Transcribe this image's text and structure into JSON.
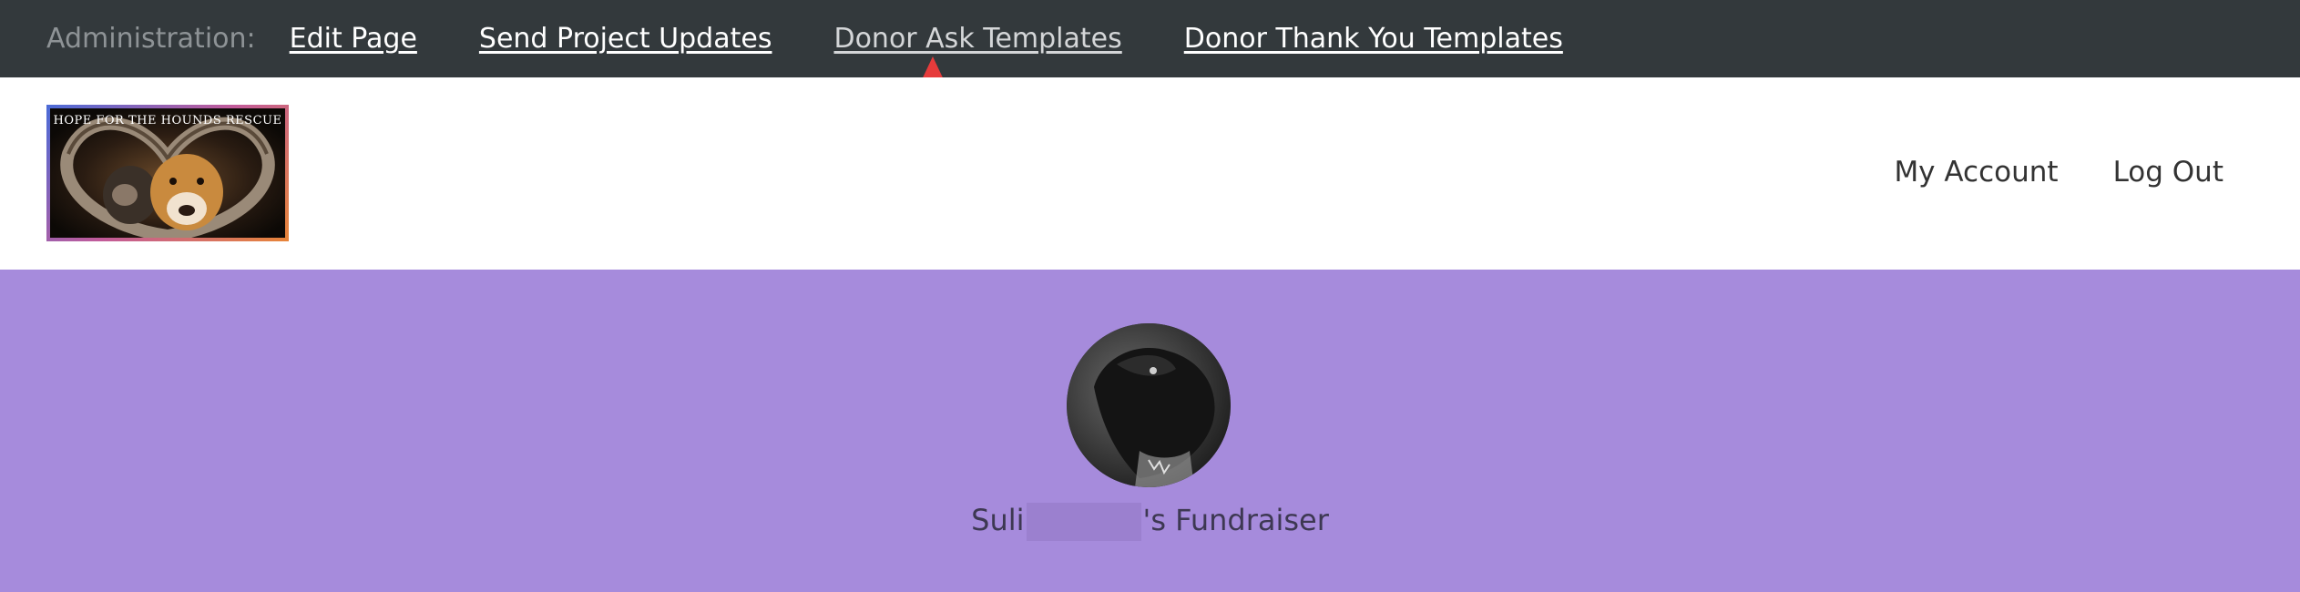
{
  "admin_bar": {
    "label": "Administration:",
    "links": [
      {
        "label": "Edit Page"
      },
      {
        "label": "Send Project Updates"
      },
      {
        "label": "Donor Ask Templates"
      },
      {
        "label": "Donor Thank You Templates"
      }
    ]
  },
  "header": {
    "logo_text": "HOPE FOR THE HOUNDS RESCUE",
    "nav": [
      {
        "label": "My Account"
      },
      {
        "label": "Log Out"
      }
    ]
  },
  "hero": {
    "title_prefix": "Suli",
    "title_suffix": "'s Fundraiser",
    "background": "#a68bdc"
  },
  "colors": {
    "admin_bar_bg": "#33393c",
    "annotation_arrow": "#e63b3b"
  }
}
